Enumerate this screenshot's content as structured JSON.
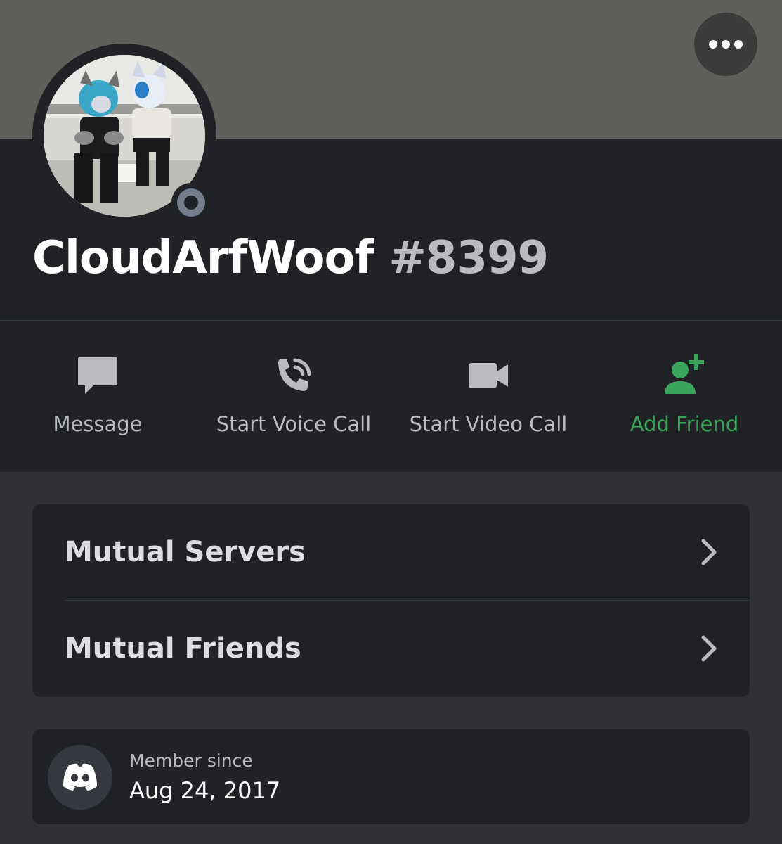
{
  "profile": {
    "username": "CloudArfWoof",
    "discriminator": "#8399",
    "status": "offline",
    "banner_color": "#5f5f5b"
  },
  "header": {
    "more_icon": "more-horizontal-icon"
  },
  "actions": [
    {
      "label": "Message",
      "icon": "chat-bubble-icon",
      "color": "#b9bbbe"
    },
    {
      "label": "Start Voice Call",
      "icon": "phone-call-icon",
      "color": "#b9bbbe"
    },
    {
      "label": "Start Video Call",
      "icon": "video-camera-icon",
      "color": "#b9bbbe"
    },
    {
      "label": "Add Friend",
      "icon": "add-friend-icon",
      "color": "#3ba55c"
    }
  ],
  "mutual": {
    "servers_label": "Mutual Servers",
    "friends_label": "Mutual Friends"
  },
  "member": {
    "label": "Member since",
    "date": "Aug 24, 2017",
    "icon": "discord-logo-icon"
  },
  "colors": {
    "accent_green": "#3ba55c",
    "panel": "#202225",
    "background": "#2f3136"
  }
}
